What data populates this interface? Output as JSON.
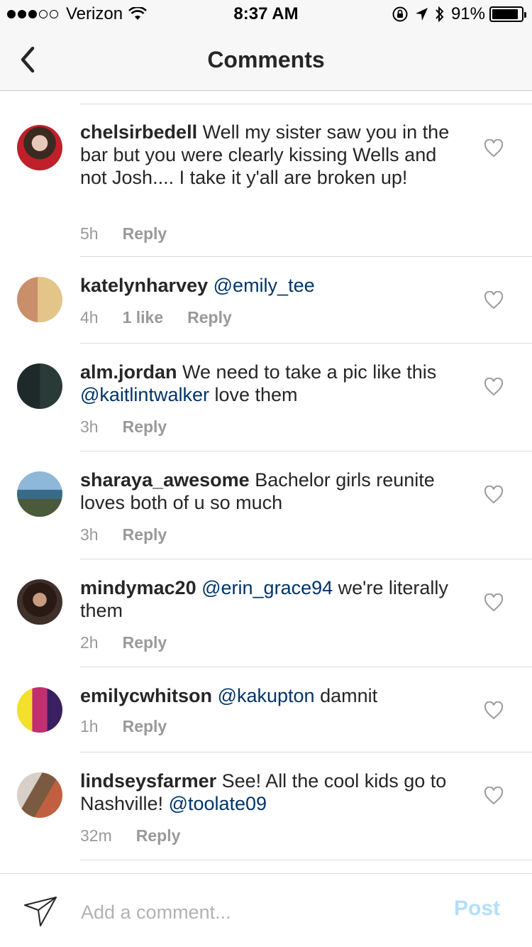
{
  "status_bar": {
    "carrier": "Verizon",
    "time": "8:37 AM",
    "battery_percent": "91%",
    "battery_level": 0.91,
    "signal_full": 3,
    "signal_empty": 2
  },
  "header": {
    "title": "Comments",
    "back_icon": "chevron-left-icon"
  },
  "comments": [
    {
      "username": "chelsirbedell",
      "text": "Well my sister saw you in the bar but you were clearly kissing Wells and not Josh.... I take it y'all are broken up!",
      "time": "5h",
      "likes": "",
      "reply": "Reply"
    },
    {
      "username": "katelynharvey",
      "mention": "@emily_tee",
      "time": "4h",
      "likes": "1 like",
      "reply": "Reply"
    },
    {
      "username": "alm.jordan",
      "text": "We need to take a pic like this",
      "mention": "@kaitlintwalker",
      "text_after": " love them",
      "time": "3h",
      "likes": "",
      "reply": "Reply"
    },
    {
      "username": "sharaya_awesome",
      "text": "Bachelor girls reunite loves both of u so much",
      "time": "3h",
      "likes": "",
      "reply": "Reply"
    },
    {
      "username": "mindymac20",
      "mention": "@erin_grace94",
      "text_after": "we're literally them",
      "time": "2h",
      "likes": "",
      "reply": "Reply"
    },
    {
      "username": "emilycwhitson",
      "mention": "@kakupton",
      "text_after": "damnit",
      "time": "1h",
      "likes": "",
      "reply": "Reply"
    },
    {
      "username": "lindseysfarmer",
      "text": "See! All the cool kids go to Nashville!",
      "mention": "@toolate09",
      "time": "32m",
      "likes": "",
      "reply": "Reply"
    }
  ],
  "composer": {
    "placeholder": "Add a comment...",
    "post_label": "Post",
    "post_color": "#b2dffc"
  },
  "colors": {
    "mention": "#003569",
    "meta": "#999999",
    "header_bg": "#f7f7f7"
  }
}
